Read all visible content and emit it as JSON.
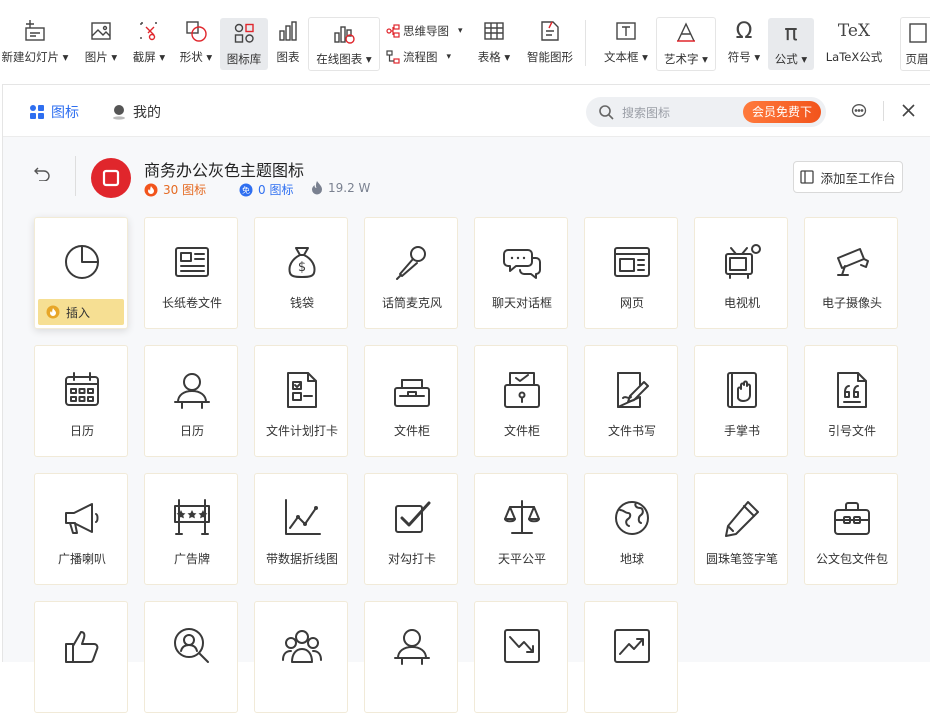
{
  "ribbon": {
    "new_slide": "新建幻灯片",
    "picture": "图片",
    "screenshot": "截屏",
    "shape": "形状",
    "icon_lib": "图标库",
    "chart": "图表",
    "online_chart": "在线图表",
    "mindmap": "思维导图",
    "flowchart": "流程图",
    "table": "表格",
    "smart_shape": "智能图形",
    "textbox": "文本框",
    "wordart": "艺术字",
    "symbol": "符号",
    "formula": "公式",
    "latex": "LaTeX公式",
    "header_footer": "页眉"
  },
  "topbar": {
    "tab_icons": "图标",
    "tab_mine": "我的",
    "search_placeholder": "搜索图标",
    "vip_button": "会员免费下"
  },
  "pack": {
    "title": "商务办公灰色主题图标",
    "count": "30 图标",
    "free": "0 图标",
    "heat": "19.2 W",
    "add_button": "添加至工作台"
  },
  "insert_label": "插入",
  "icons": [
    {
      "label": "",
      "icon": "pie-chart"
    },
    {
      "label": "长纸卷文件",
      "icon": "newspaper"
    },
    {
      "label": "钱袋",
      "icon": "money-bag"
    },
    {
      "label": "话筒麦克风",
      "icon": "microphone"
    },
    {
      "label": "聊天对话框",
      "icon": "chat-bubbles"
    },
    {
      "label": "网页",
      "icon": "webpage"
    },
    {
      "label": "电视机",
      "icon": "television"
    },
    {
      "label": "电子摄像头",
      "icon": "security-camera"
    },
    {
      "label": "日历",
      "icon": "calendar"
    },
    {
      "label": "日历",
      "icon": "person-desk"
    },
    {
      "label": "文件计划打卡",
      "icon": "file-checklist"
    },
    {
      "label": "文件柜",
      "icon": "file-cabinet"
    },
    {
      "label": "文件柜",
      "icon": "file-cabinet-lock"
    },
    {
      "label": "文件书写",
      "icon": "document-writing"
    },
    {
      "label": "手掌书",
      "icon": "hand-book"
    },
    {
      "label": "引号文件",
      "icon": "quote-file"
    },
    {
      "label": "广播喇叭",
      "icon": "megaphone"
    },
    {
      "label": "广告牌",
      "icon": "billboard"
    },
    {
      "label": "带数据折线图",
      "icon": "line-chart"
    },
    {
      "label": "对勾打卡",
      "icon": "checkbox"
    },
    {
      "label": "天平公平",
      "icon": "balance-scale"
    },
    {
      "label": "地球",
      "icon": "globe"
    },
    {
      "label": "圆珠笔签字笔",
      "icon": "pen"
    },
    {
      "label": "公文包文件包",
      "icon": "briefcase"
    },
    {
      "label": "",
      "icon": "thumbs-up"
    },
    {
      "label": "",
      "icon": "search-person"
    },
    {
      "label": "",
      "icon": "group"
    },
    {
      "label": "",
      "icon": "person-desk"
    },
    {
      "label": "",
      "icon": "trend-down"
    },
    {
      "label": "",
      "icon": "trend-up"
    }
  ]
}
